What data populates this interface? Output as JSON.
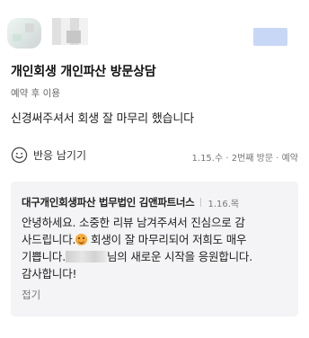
{
  "review": {
    "title": "개인회생 개인파산 방문상담",
    "subtitle": "예약 후 이용",
    "body": "신경써주셔서 회생 잘 마무리 했습니다",
    "reply_label": "반응 남기기",
    "meta": "1.15.수 · 2번째 방문 · 예약"
  },
  "owner_reply": {
    "business_name": "대구개인회생파산 법무법인 김앤파트너스",
    "date": "1.16.목",
    "text_line1": "안녕하세요. 소중한 리뷰 남겨주셔서 진심으로 감",
    "text_line2a": "사드립니다.",
    "text_line2b": " 회생이 잘 마무리되어 저희도 매우",
    "text_line3a": "기쁩니다.",
    "text_line3b": "님의 새로운 시작을 응원합니다.",
    "text_line4": "감사합니다!",
    "collapse_label": "접기"
  },
  "icons": {
    "reaction": "smile-icon",
    "emoji": "smiling-face-emoji"
  }
}
